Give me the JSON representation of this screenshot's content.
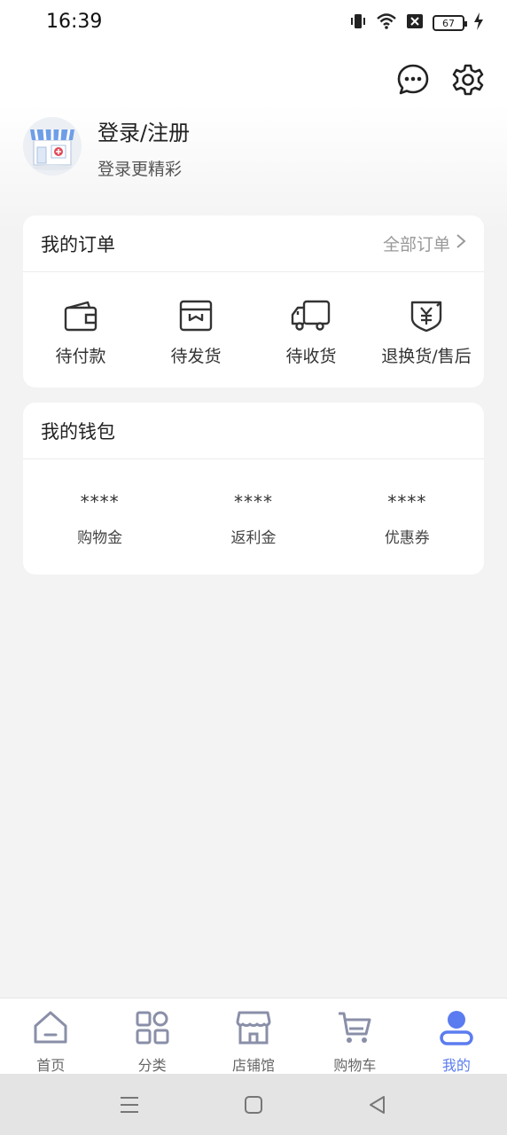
{
  "status_bar": {
    "time": "16:39",
    "battery": "67",
    "icons": [
      "vibrate-icon",
      "wifi-icon",
      "no-sim-icon",
      "battery-icon",
      "charging-icon"
    ]
  },
  "header": {
    "icons": [
      "message-icon",
      "settings-icon"
    ]
  },
  "profile": {
    "title": "登录/注册",
    "subtitle": "登录更精彩",
    "avatar_icon": "shop-avatar-icon"
  },
  "orders": {
    "title": "我的订单",
    "all_link": "全部订单",
    "items": [
      {
        "label": "待付款",
        "icon": "wallet-icon"
      },
      {
        "label": "待发货",
        "icon": "box-icon"
      },
      {
        "label": "待收货",
        "icon": "truck-icon"
      },
      {
        "label": "退换货/售后",
        "icon": "refund-icon"
      }
    ]
  },
  "wallet": {
    "title": "我的钱包",
    "items": [
      {
        "value": "****",
        "label": "购物金"
      },
      {
        "value": "****",
        "label": "返利金"
      },
      {
        "value": "****",
        "label": "优惠券"
      }
    ]
  },
  "tabs": [
    {
      "label": "首页",
      "icon": "home-icon"
    },
    {
      "label": "分类",
      "icon": "category-icon"
    },
    {
      "label": "店铺馆",
      "icon": "store-icon"
    },
    {
      "label": "购物车",
      "icon": "cart-icon"
    },
    {
      "label": "我的",
      "icon": "profile-icon",
      "active": true
    }
  ],
  "colors": {
    "accent": "#5b7cf0",
    "tab_inactive": "#8a8fa8",
    "background": "#f3f3f3"
  }
}
